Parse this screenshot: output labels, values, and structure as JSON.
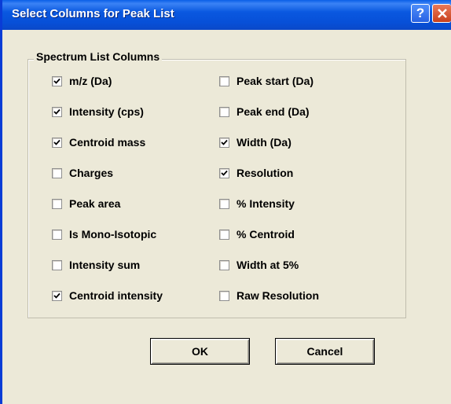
{
  "window": {
    "title": "Select Columns for Peak List",
    "help_icon": "question-mark-icon",
    "close_icon": "close-x-icon"
  },
  "group": {
    "legend": "Spectrum List Columns"
  },
  "columns_left": [
    {
      "label": "m/z (Da)",
      "checked": true
    },
    {
      "label": "Intensity (cps)",
      "checked": true
    },
    {
      "label": "Centroid mass",
      "checked": true
    },
    {
      "label": "Charges",
      "checked": false
    },
    {
      "label": "Peak area",
      "checked": false
    },
    {
      "label": "Is Mono-Isotopic",
      "checked": false
    },
    {
      "label": "Intensity sum",
      "checked": false
    },
    {
      "label": "Centroid intensity",
      "checked": true
    }
  ],
  "columns_right": [
    {
      "label": "Peak start (Da)",
      "checked": false
    },
    {
      "label": "Peak end (Da)",
      "checked": false
    },
    {
      "label": "Width (Da)",
      "checked": true
    },
    {
      "label": "Resolution",
      "checked": true
    },
    {
      "label": "% Intensity",
      "checked": false
    },
    {
      "label": "% Centroid",
      "checked": false
    },
    {
      "label": "Width at 5%",
      "checked": false
    },
    {
      "label": "Raw Resolution",
      "checked": false
    }
  ],
  "buttons": {
    "ok": "OK",
    "cancel": "Cancel"
  },
  "colors": {
    "titlebar": "#0a58e0",
    "dialog_face": "#ece9d8",
    "close_button": "#c8401c"
  }
}
